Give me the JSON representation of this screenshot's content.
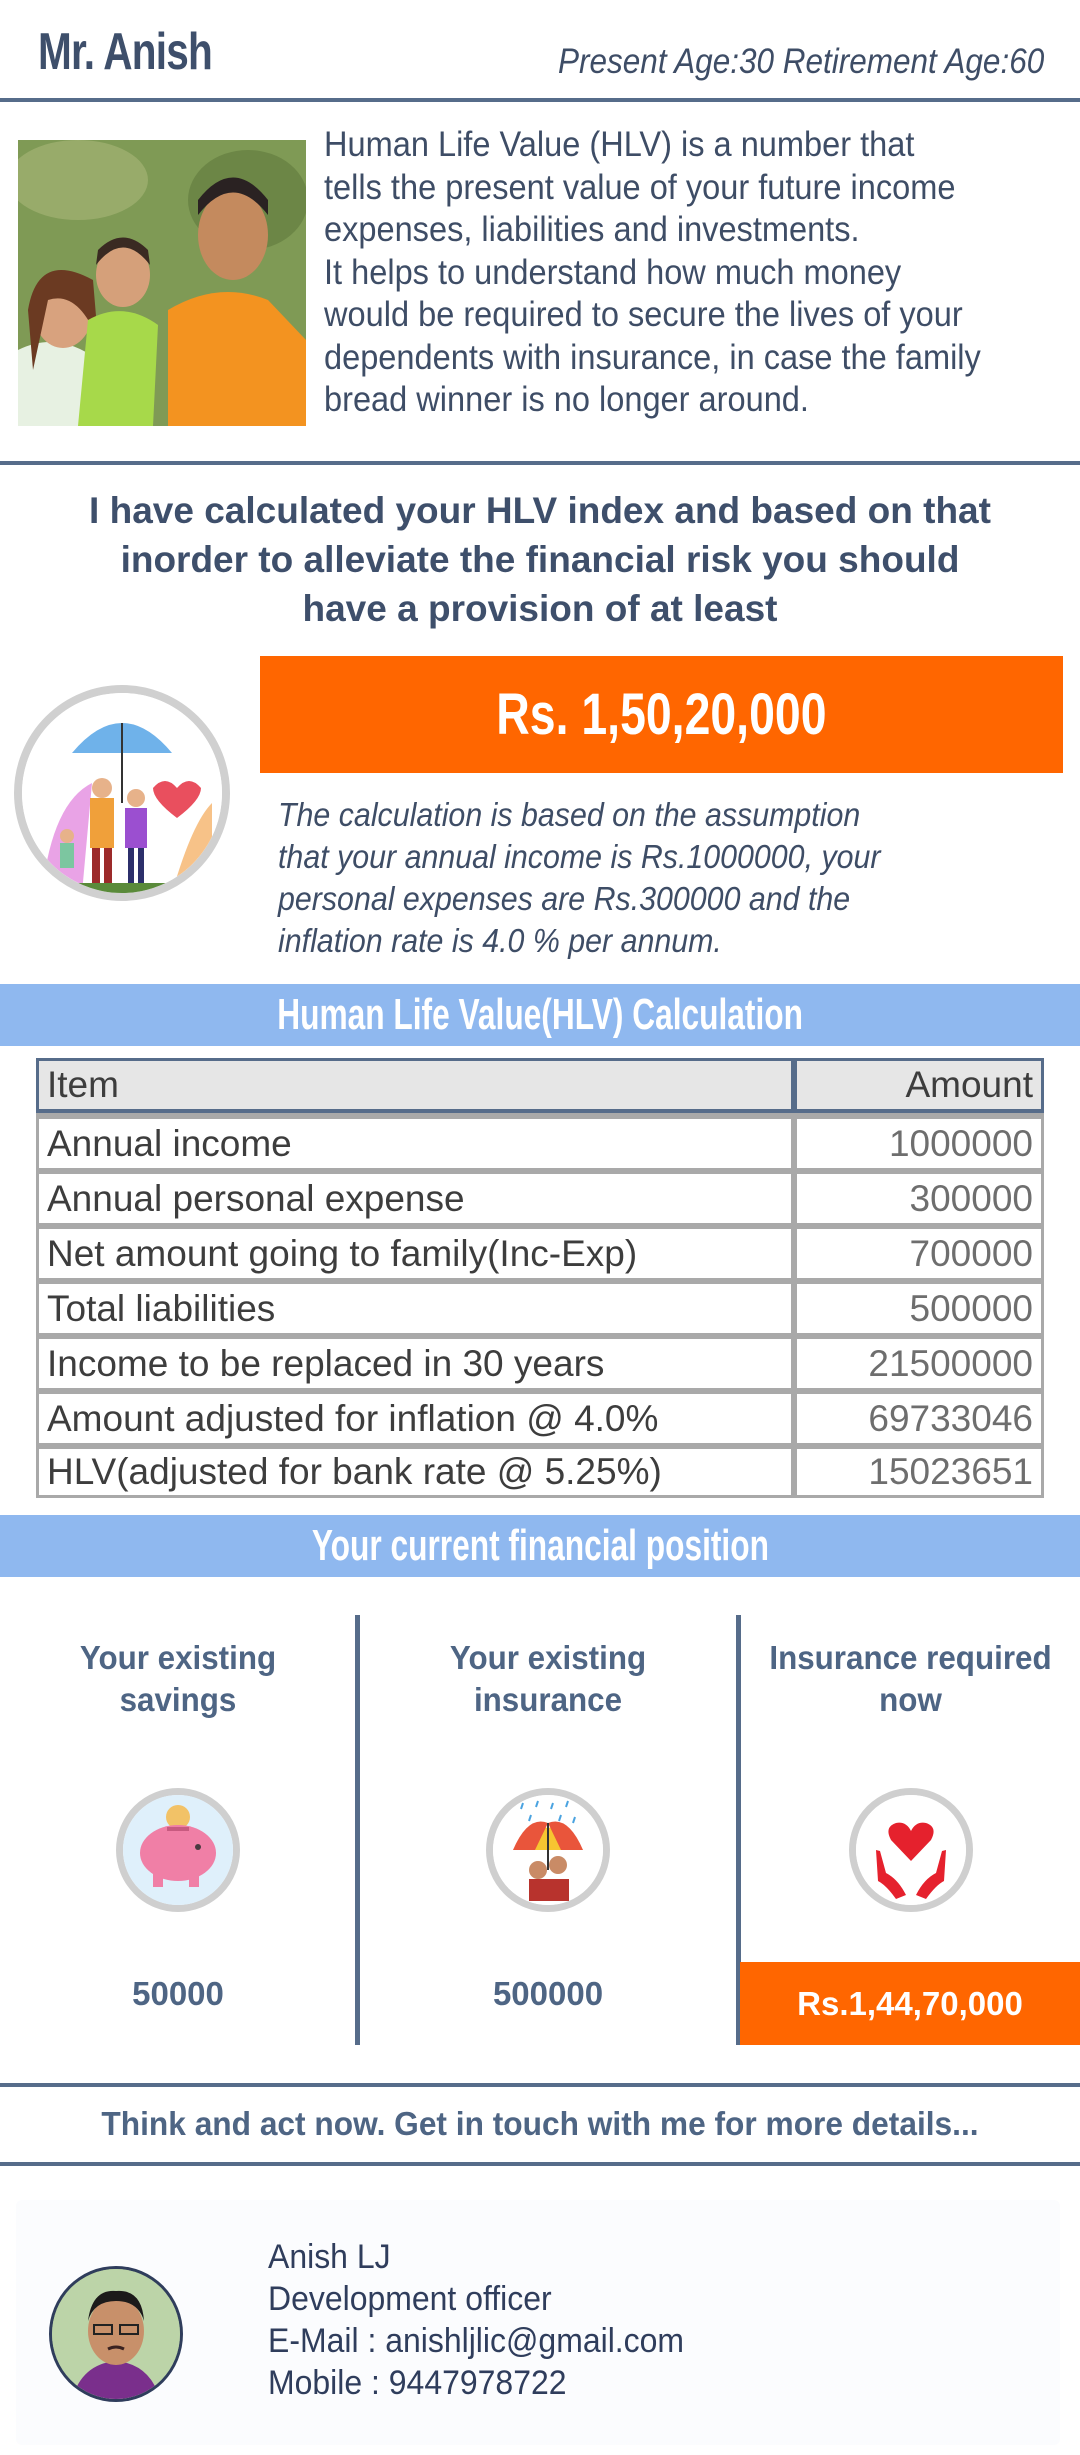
{
  "header": {
    "name": "Mr. Anish",
    "age_info": "Present Age:30 Retirement Age:60"
  },
  "intro": {
    "photo_alt": "family-photo",
    "lines": [
      "Human Life Value (HLV) is a number that",
      "tells the present value of your future income",
      "expenses, liabilities and investments.",
      "It helps to understand how much money",
      "would be required to secure the lives of your",
      "dependents with insurance, in case the family",
      "bread winner is no longer around."
    ]
  },
  "headline": {
    "lines": [
      "I have calculated your HLV index and based on that",
      "inorder to alleviate the financial risk you should",
      "have a provision of at least"
    ]
  },
  "provision": {
    "amount": "Rs. 1,50,20,000",
    "assumption_lines": [
      "The calculation is based on the assumption",
      "that your annual income is Rs.1000000, your",
      "personal expenses are Rs.300000 and the",
      "inflation rate is 4.0 % per annum."
    ]
  },
  "hlv_section": {
    "title": "Human Life Value(HLV) Calculation",
    "columns": [
      "Item",
      "Amount"
    ],
    "rows": [
      {
        "item": "Annual income",
        "amount": "1000000"
      },
      {
        "item": "Annual personal expense",
        "amount": "300000"
      },
      {
        "item": "Net amount going to family(Inc-Exp)",
        "amount": "700000"
      },
      {
        "item": "Total liabilities",
        "amount": "500000"
      },
      {
        "item": "Income to be replaced in 30 years",
        "amount": "21500000"
      },
      {
        "item": "Amount adjusted for inflation @ 4.0%",
        "amount": "69733046"
      },
      {
        "item": "HLV(adjusted for bank rate @ 5.25%)",
        "amount": "15023651"
      }
    ]
  },
  "position_section": {
    "title": "Your current financial position",
    "columns": [
      {
        "title_1": "Your existing",
        "title_2": "savings",
        "icon": "piggy-bank-icon",
        "value": "50000"
      },
      {
        "title_1": "Your existing",
        "title_2": "insurance",
        "icon": "umbrella-family-icon",
        "value": "500000"
      },
      {
        "title_1": "Insurance required",
        "title_2": "now",
        "icon": "heart-hands-icon",
        "value": "Rs.1,44,70,000"
      }
    ]
  },
  "cta": "Think and act now. Get in touch with me for more details...",
  "contact": {
    "name": "Anish LJ",
    "designation": "Development officer",
    "email": "E-Mail : anishljlic@gmail.com",
    "mobile": "Mobile : 9447978722"
  },
  "colors": {
    "accent_orange": "#ff6600",
    "band_blue": "#8fb8ef",
    "text_slate": "#3e4f6b",
    "rule": "#566c8a"
  }
}
